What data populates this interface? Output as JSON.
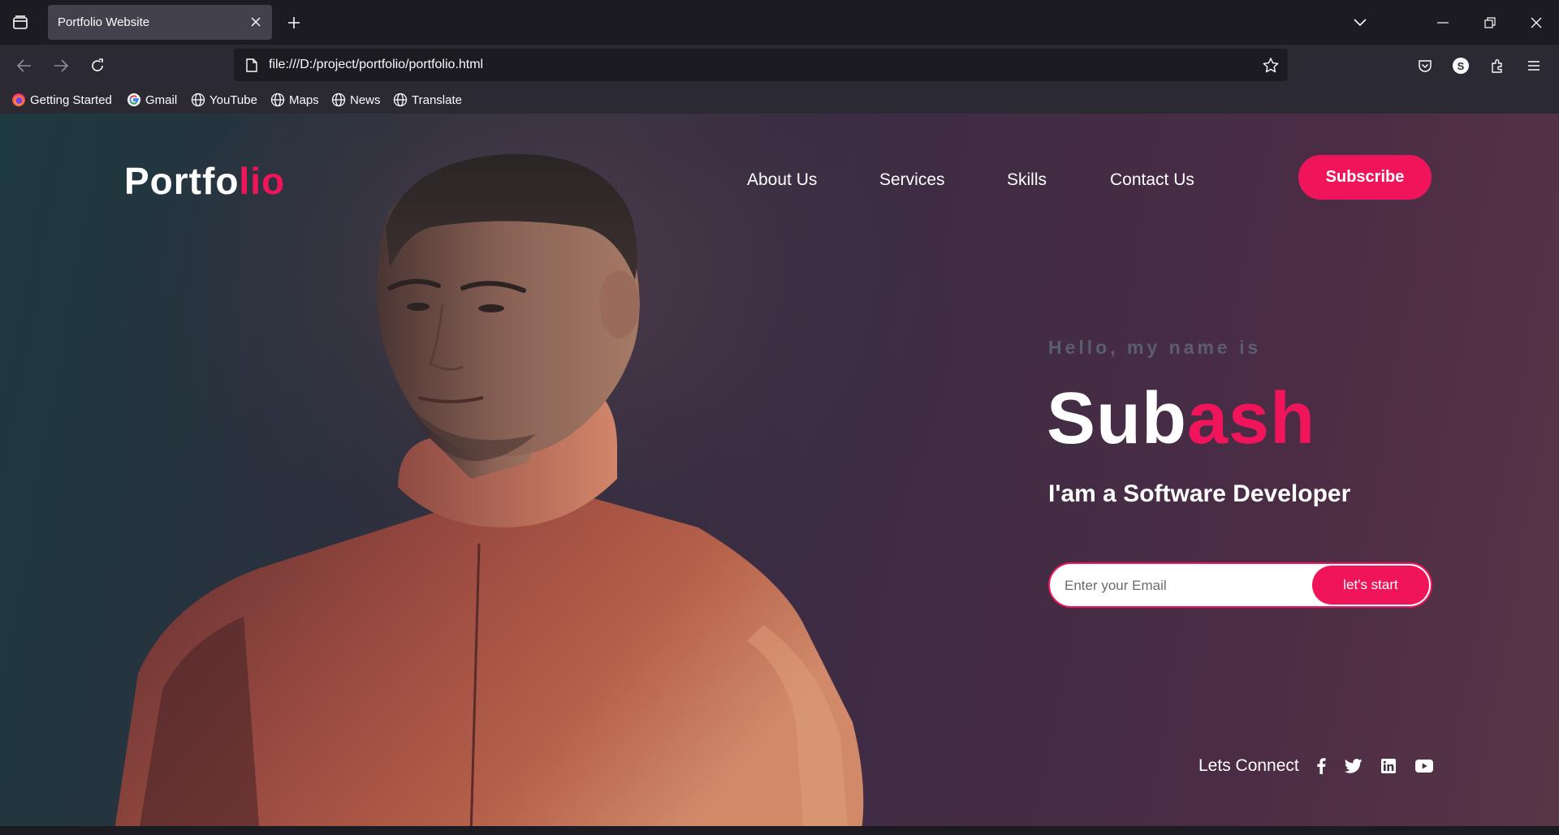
{
  "browser": {
    "tab_title": "Portfolio Website",
    "url": "file:///D:/project/portfolio/portfolio.html",
    "profile_initial": "S",
    "bookmarks": [
      {
        "label": "Getting Started",
        "icon": "firefox-icon"
      },
      {
        "label": "Gmail",
        "icon": "google-icon"
      },
      {
        "label": "YouTube",
        "icon": "globe-icon"
      },
      {
        "label": "Maps",
        "icon": "globe-icon"
      },
      {
        "label": "News",
        "icon": "globe-icon"
      },
      {
        "label": "Translate",
        "icon": "globe-icon"
      }
    ]
  },
  "site": {
    "logo_main": "Portfo",
    "logo_accent": "lio",
    "nav": [
      "About Us",
      "Services",
      "Skills",
      "Contact Us"
    ],
    "subscribe_label": "Subscribe",
    "hello": "Hello, my name is",
    "name_main": "Sub",
    "name_accent": "ash",
    "role": "I'am a Software Developer",
    "email_placeholder": "Enter your Email",
    "start_label": "let's start",
    "connect_label": "Lets Connect",
    "social_icons": [
      "facebook-icon",
      "twitter-icon",
      "linkedin-icon",
      "youtube-icon"
    ]
  },
  "colors": {
    "accent": "#f0145a",
    "chrome_dark": "#1c1b22",
    "chrome_toolbar": "#2b2a33",
    "tab_active": "#42414d"
  }
}
